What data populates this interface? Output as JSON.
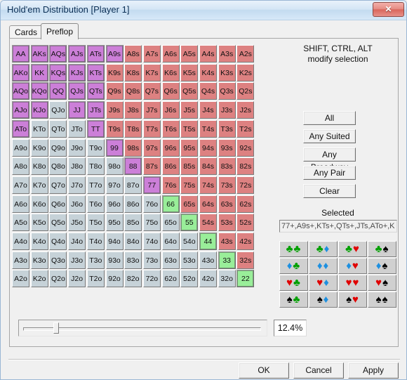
{
  "window": {
    "title": "Hold'em Distribution [Player 1]",
    "close_label": "✕"
  },
  "tabs": [
    {
      "id": "cards",
      "label": "Cards",
      "active": false
    },
    {
      "id": "preflop",
      "label": "Preflop",
      "active": true
    }
  ],
  "right_panel": {
    "modifier_line1": "SHIFT, CTRL, ALT",
    "modifier_line2": "modify selection",
    "buttons": [
      {
        "id": "all",
        "label": "All"
      },
      {
        "id": "suited",
        "label": "Any Suited"
      },
      {
        "id": "broadway",
        "label": "Any Broadway"
      },
      {
        "id": "pair",
        "label": "Any Pair"
      },
      {
        "id": "clear",
        "label": "Clear"
      }
    ],
    "selected_label": "Selected",
    "selected_value": "77+,A9s+,KTs+,QTs+,JTs,ATo+,K",
    "suit_rows": [
      [
        [
          "c",
          "c"
        ],
        [
          "c",
          "d"
        ],
        [
          "c",
          "h"
        ],
        [
          "c",
          "s"
        ]
      ],
      [
        [
          "d",
          "c"
        ],
        [
          "d",
          "d"
        ],
        [
          "d",
          "h"
        ],
        [
          "d",
          "s"
        ]
      ],
      [
        [
          "h",
          "c"
        ],
        [
          "h",
          "d"
        ],
        [
          "h",
          "h"
        ],
        [
          "h",
          "s"
        ]
      ],
      [
        [
          "s",
          "c"
        ],
        [
          "s",
          "d"
        ],
        [
          "s",
          "h"
        ],
        [
          "s",
          "s"
        ]
      ]
    ]
  },
  "slider": {
    "value_label": "12.4%",
    "position_pct": 13
  },
  "footer": {
    "buttons": [
      {
        "id": "ok",
        "label": "OK"
      },
      {
        "id": "cancel",
        "label": "Cancel"
      },
      {
        "id": "apply",
        "label": "Apply"
      }
    ]
  },
  "colors": {
    "selected_purple": "#cc7fd8",
    "suited_red": "#dd8181",
    "offsuit_gray": "#c6d2d8",
    "pair_green": "#99ee99"
  },
  "grid": {
    "ranks": [
      "A",
      "K",
      "Q",
      "J",
      "T",
      "9",
      "8",
      "7",
      "6",
      "5",
      "4",
      "3",
      "2"
    ],
    "rows": [
      [
        {
          "l": "AA",
          "c": "p"
        },
        {
          "l": "AKs",
          "c": "p"
        },
        {
          "l": "AQs",
          "c": "p"
        },
        {
          "l": "AJs",
          "c": "p"
        },
        {
          "l": "ATs",
          "c": "p"
        },
        {
          "l": "A9s",
          "c": "p"
        },
        {
          "l": "A8s",
          "c": "r"
        },
        {
          "l": "A7s",
          "c": "r"
        },
        {
          "l": "A6s",
          "c": "r"
        },
        {
          "l": "A5s",
          "c": "r"
        },
        {
          "l": "A4s",
          "c": "r"
        },
        {
          "l": "A3s",
          "c": "r"
        },
        {
          "l": "A2s",
          "c": "r"
        }
      ],
      [
        {
          "l": "AKo",
          "c": "p"
        },
        {
          "l": "KK",
          "c": "p"
        },
        {
          "l": "KQs",
          "c": "p"
        },
        {
          "l": "KJs",
          "c": "p"
        },
        {
          "l": "KTs",
          "c": "p"
        },
        {
          "l": "K9s",
          "c": "r"
        },
        {
          "l": "K8s",
          "c": "r"
        },
        {
          "l": "K7s",
          "c": "r"
        },
        {
          "l": "K6s",
          "c": "r"
        },
        {
          "l": "K5s",
          "c": "r"
        },
        {
          "l": "K4s",
          "c": "r"
        },
        {
          "l": "K3s",
          "c": "r"
        },
        {
          "l": "K2s",
          "c": "r"
        }
      ],
      [
        {
          "l": "AQo",
          "c": "p"
        },
        {
          "l": "KQo",
          "c": "p"
        },
        {
          "l": "QQ",
          "c": "p"
        },
        {
          "l": "QJs",
          "c": "p"
        },
        {
          "l": "QTs",
          "c": "p"
        },
        {
          "l": "Q9s",
          "c": "r"
        },
        {
          "l": "Q8s",
          "c": "r"
        },
        {
          "l": "Q7s",
          "c": "r"
        },
        {
          "l": "Q6s",
          "c": "r"
        },
        {
          "l": "Q5s",
          "c": "r"
        },
        {
          "l": "Q4s",
          "c": "r"
        },
        {
          "l": "Q3s",
          "c": "r"
        },
        {
          "l": "Q2s",
          "c": "r"
        }
      ],
      [
        {
          "l": "AJo",
          "c": "p"
        },
        {
          "l": "KJo",
          "c": "p"
        },
        {
          "l": "QJo",
          "c": "g"
        },
        {
          "l": "JJ",
          "c": "p"
        },
        {
          "l": "JTs",
          "c": "p"
        },
        {
          "l": "J9s",
          "c": "r"
        },
        {
          "l": "J8s",
          "c": "r"
        },
        {
          "l": "J7s",
          "c": "r"
        },
        {
          "l": "J6s",
          "c": "r"
        },
        {
          "l": "J5s",
          "c": "r"
        },
        {
          "l": "J4s",
          "c": "r"
        },
        {
          "l": "J3s",
          "c": "r"
        },
        {
          "l": "J2s",
          "c": "r"
        }
      ],
      [
        {
          "l": "ATo",
          "c": "p"
        },
        {
          "l": "KTo",
          "c": "g"
        },
        {
          "l": "QTo",
          "c": "g"
        },
        {
          "l": "JTo",
          "c": "g"
        },
        {
          "l": "TT",
          "c": "p"
        },
        {
          "l": "T9s",
          "c": "r"
        },
        {
          "l": "T8s",
          "c": "r"
        },
        {
          "l": "T7s",
          "c": "r"
        },
        {
          "l": "T6s",
          "c": "r"
        },
        {
          "l": "T5s",
          "c": "r"
        },
        {
          "l": "T4s",
          "c": "r"
        },
        {
          "l": "T3s",
          "c": "r"
        },
        {
          "l": "T2s",
          "c": "r"
        }
      ],
      [
        {
          "l": "A9o",
          "c": "g"
        },
        {
          "l": "K9o",
          "c": "g"
        },
        {
          "l": "Q9o",
          "c": "g"
        },
        {
          "l": "J9o",
          "c": "g"
        },
        {
          "l": "T9o",
          "c": "g"
        },
        {
          "l": "99",
          "c": "p"
        },
        {
          "l": "98s",
          "c": "r"
        },
        {
          "l": "97s",
          "c": "r"
        },
        {
          "l": "96s",
          "c": "r"
        },
        {
          "l": "95s",
          "c": "r"
        },
        {
          "l": "94s",
          "c": "r"
        },
        {
          "l": "93s",
          "c": "r"
        },
        {
          "l": "92s",
          "c": "r"
        }
      ],
      [
        {
          "l": "A8o",
          "c": "g"
        },
        {
          "l": "K8o",
          "c": "g"
        },
        {
          "l": "Q8o",
          "c": "g"
        },
        {
          "l": "J8o",
          "c": "g"
        },
        {
          "l": "T8o",
          "c": "g"
        },
        {
          "l": "98o",
          "c": "g"
        },
        {
          "l": "88",
          "c": "p"
        },
        {
          "l": "87s",
          "c": "r"
        },
        {
          "l": "86s",
          "c": "r"
        },
        {
          "l": "85s",
          "c": "r"
        },
        {
          "l": "84s",
          "c": "r"
        },
        {
          "l": "83s",
          "c": "r"
        },
        {
          "l": "82s",
          "c": "r"
        }
      ],
      [
        {
          "l": "A7o",
          "c": "g"
        },
        {
          "l": "K7o",
          "c": "g"
        },
        {
          "l": "Q7o",
          "c": "g"
        },
        {
          "l": "J7o",
          "c": "g"
        },
        {
          "l": "T7o",
          "c": "g"
        },
        {
          "l": "97o",
          "c": "g"
        },
        {
          "l": "87o",
          "c": "g"
        },
        {
          "l": "77",
          "c": "p"
        },
        {
          "l": "76s",
          "c": "r"
        },
        {
          "l": "75s",
          "c": "r"
        },
        {
          "l": "74s",
          "c": "r"
        },
        {
          "l": "73s",
          "c": "r"
        },
        {
          "l": "72s",
          "c": "r"
        }
      ],
      [
        {
          "l": "A6o",
          "c": "g"
        },
        {
          "l": "K6o",
          "c": "g"
        },
        {
          "l": "Q6o",
          "c": "g"
        },
        {
          "l": "J6o",
          "c": "g"
        },
        {
          "l": "T6o",
          "c": "g"
        },
        {
          "l": "96o",
          "c": "g"
        },
        {
          "l": "86o",
          "c": "g"
        },
        {
          "l": "76o",
          "c": "g"
        },
        {
          "l": "66",
          "c": "n"
        },
        {
          "l": "65s",
          "c": "r"
        },
        {
          "l": "64s",
          "c": "r"
        },
        {
          "l": "63s",
          "c": "r"
        },
        {
          "l": "62s",
          "c": "r"
        }
      ],
      [
        {
          "l": "A5o",
          "c": "g"
        },
        {
          "l": "K5o",
          "c": "g"
        },
        {
          "l": "Q5o",
          "c": "g"
        },
        {
          "l": "J5o",
          "c": "g"
        },
        {
          "l": "T5o",
          "c": "g"
        },
        {
          "l": "95o",
          "c": "g"
        },
        {
          "l": "85o",
          "c": "g"
        },
        {
          "l": "75o",
          "c": "g"
        },
        {
          "l": "65o",
          "c": "g"
        },
        {
          "l": "55",
          "c": "n"
        },
        {
          "l": "54s",
          "c": "r"
        },
        {
          "l": "53s",
          "c": "r"
        },
        {
          "l": "52s",
          "c": "r"
        }
      ],
      [
        {
          "l": "A4o",
          "c": "g"
        },
        {
          "l": "K4o",
          "c": "g"
        },
        {
          "l": "Q4o",
          "c": "g"
        },
        {
          "l": "J4o",
          "c": "g"
        },
        {
          "l": "T4o",
          "c": "g"
        },
        {
          "l": "94o",
          "c": "g"
        },
        {
          "l": "84o",
          "c": "g"
        },
        {
          "l": "74o",
          "c": "g"
        },
        {
          "l": "64o",
          "c": "g"
        },
        {
          "l": "54o",
          "c": "g"
        },
        {
          "l": "44",
          "c": "n"
        },
        {
          "l": "43s",
          "c": "r"
        },
        {
          "l": "42s",
          "c": "r"
        }
      ],
      [
        {
          "l": "A3o",
          "c": "g"
        },
        {
          "l": "K3o",
          "c": "g"
        },
        {
          "l": "Q3o",
          "c": "g"
        },
        {
          "l": "J3o",
          "c": "g"
        },
        {
          "l": "T3o",
          "c": "g"
        },
        {
          "l": "93o",
          "c": "g"
        },
        {
          "l": "83o",
          "c": "g"
        },
        {
          "l": "73o",
          "c": "g"
        },
        {
          "l": "63o",
          "c": "g"
        },
        {
          "l": "53o",
          "c": "g"
        },
        {
          "l": "43o",
          "c": "g"
        },
        {
          "l": "33",
          "c": "n"
        },
        {
          "l": "32s",
          "c": "r"
        }
      ],
      [
        {
          "l": "A2o",
          "c": "g"
        },
        {
          "l": "K2o",
          "c": "g"
        },
        {
          "l": "Q2o",
          "c": "g"
        },
        {
          "l": "J2o",
          "c": "g"
        },
        {
          "l": "T2o",
          "c": "g"
        },
        {
          "l": "92o",
          "c": "g"
        },
        {
          "l": "82o",
          "c": "g"
        },
        {
          "l": "72o",
          "c": "g"
        },
        {
          "l": "62o",
          "c": "g"
        },
        {
          "l": "52o",
          "c": "g"
        },
        {
          "l": "42o",
          "c": "g"
        },
        {
          "l": "32o",
          "c": "g"
        },
        {
          "l": "22",
          "c": "n"
        }
      ]
    ]
  }
}
